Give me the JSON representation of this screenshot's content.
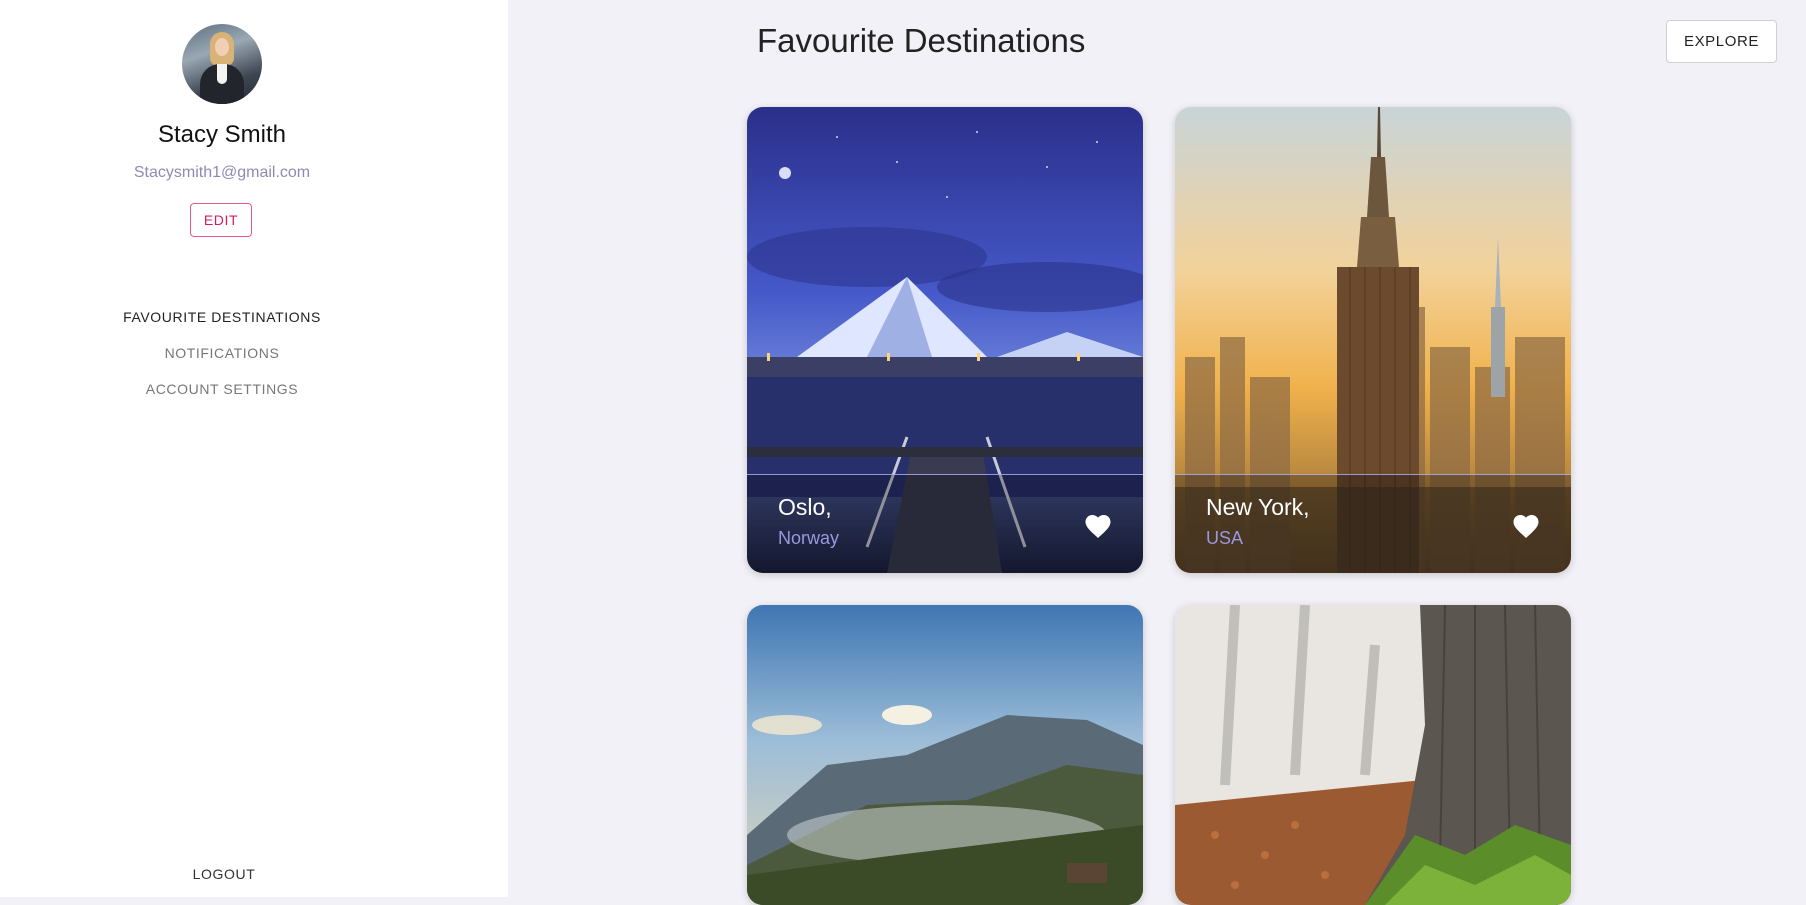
{
  "profile": {
    "name": "Stacy Smith",
    "email": "Stacysmith1@gmail.com",
    "edit_label": "EDIT"
  },
  "nav": {
    "items": [
      {
        "label": "FAVOURITE DESTINATIONS",
        "active": true
      },
      {
        "label": "NOTIFICATIONS",
        "active": false
      },
      {
        "label": "ACCOUNT SETTINGS",
        "active": false
      }
    ],
    "logout_label": "LOGOUT"
  },
  "header": {
    "title": "Favourite Destinations",
    "explore_label": "EXPLORE"
  },
  "destinations": [
    {
      "city": "Oslo,",
      "country": "Norway",
      "favourite": true
    },
    {
      "city": "New York,",
      "country": "USA",
      "favourite": true
    },
    {
      "city": "",
      "country": "",
      "favourite": false
    },
    {
      "city": "",
      "country": "",
      "favourite": false
    }
  ],
  "icons": {
    "favourite": "heart-icon"
  },
  "colors": {
    "accent_pink": "#d81b60",
    "country_text": "#9b97df",
    "background": "#f1f1f7",
    "sidebar": "#ffffff"
  }
}
